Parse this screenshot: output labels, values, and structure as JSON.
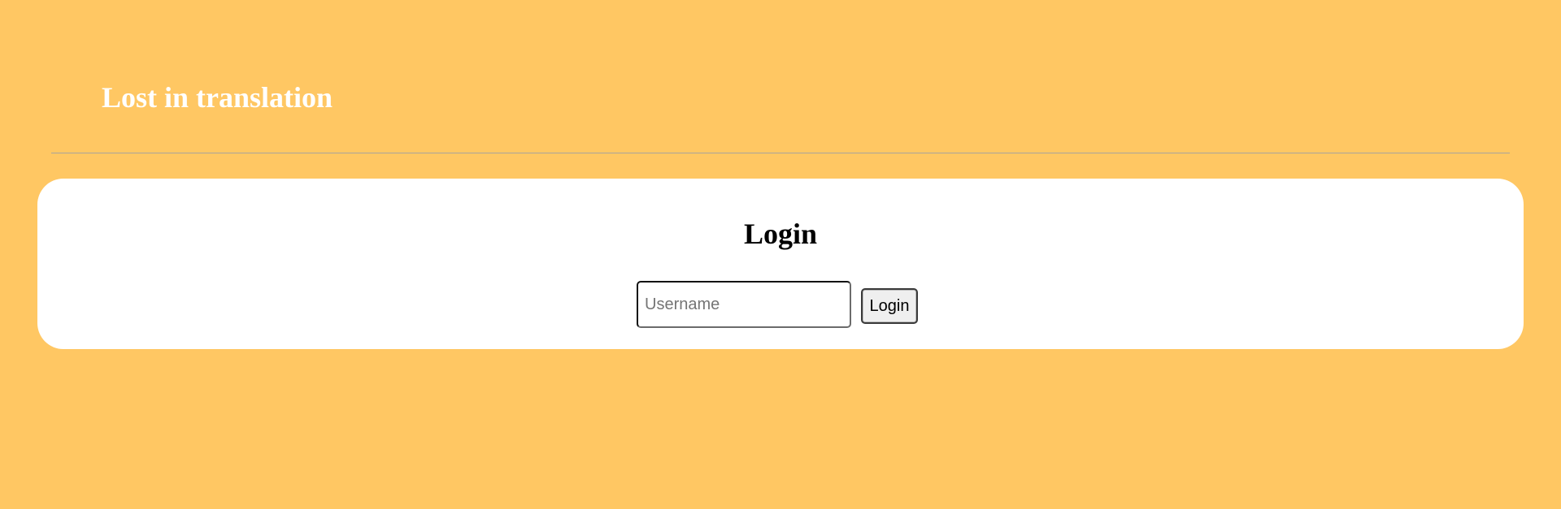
{
  "header": {
    "title": "Lost in translation"
  },
  "login": {
    "heading": "Login",
    "username_placeholder": "Username",
    "username_value": "",
    "button_label": "Login"
  },
  "colors": {
    "background": "#ffc763",
    "card": "#ffffff",
    "title_text": "#ffffff"
  }
}
